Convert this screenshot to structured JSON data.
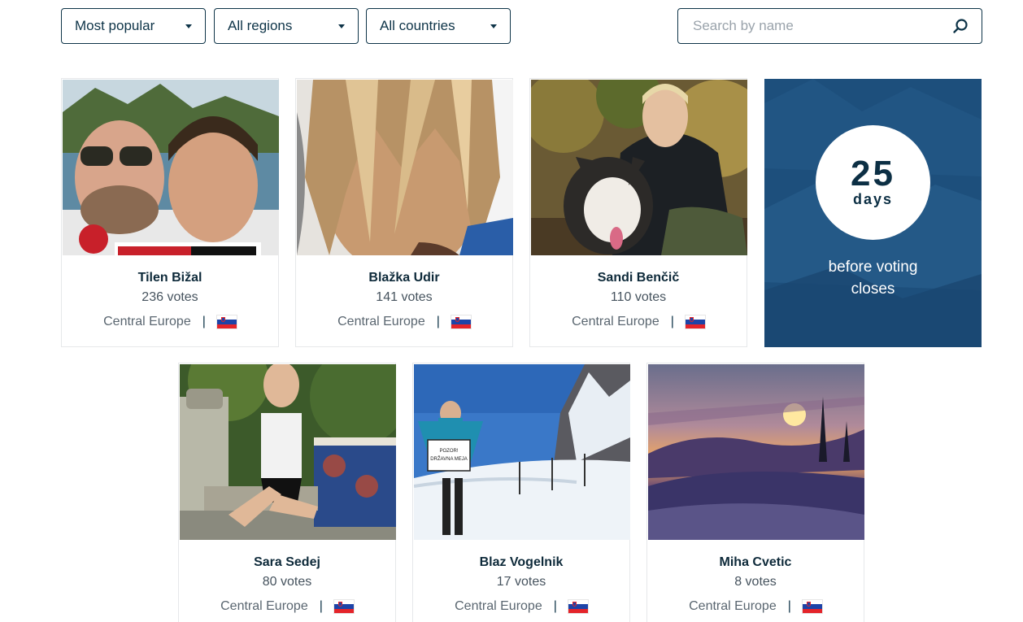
{
  "filters": {
    "sort": "Most popular",
    "region": "All regions",
    "country": "All countries"
  },
  "search": {
    "placeholder": "Search by name"
  },
  "countdown": {
    "number": "25",
    "unit": "days",
    "caption_line1": "before voting",
    "caption_line2": "closes"
  },
  "cards": [
    {
      "name": "Tilen Bižal",
      "votes": "236 votes",
      "region": "Central Europe",
      "country_flag": "slovenia-flag"
    },
    {
      "name": "Blažka Udir",
      "votes": "141 votes",
      "region": "Central Europe",
      "country_flag": "slovenia-flag"
    },
    {
      "name": "Sandi Benčič",
      "votes": "110 votes",
      "region": "Central Europe",
      "country_flag": "slovenia-flag"
    },
    {
      "name": "Sara Sedej",
      "votes": "80 votes",
      "region": "Central Europe",
      "country_flag": "slovenia-flag"
    },
    {
      "name": "Blaz Vogelnik",
      "votes": "17 votes",
      "region": "Central Europe",
      "country_flag": "slovenia-flag"
    },
    {
      "name": "Miha Cvetic",
      "votes": "8 votes",
      "region": "Central Europe",
      "country_flag": "slovenia-flag"
    }
  ],
  "photo_texts": {
    "sign_line1": "POZOR!",
    "sign_line2": "DRŽAVNA MEJA"
  },
  "colors": {
    "primary": "#0e3448",
    "countdown_bg": "#1d4f7c",
    "flag_blue": "#1d44a8",
    "flag_red": "#e4242a"
  }
}
